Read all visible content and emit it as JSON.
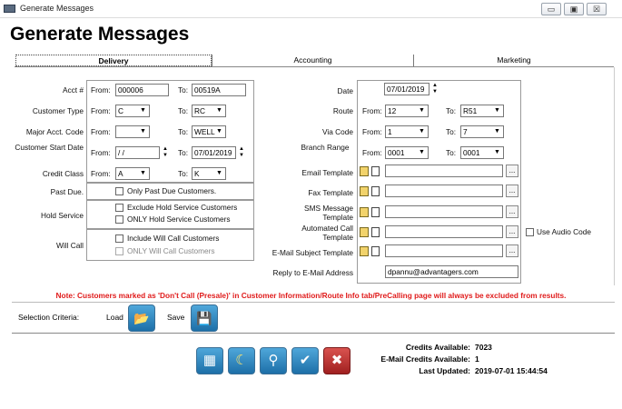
{
  "window": {
    "title": "Generate Messages",
    "minimize": "▭",
    "maximize": "▣",
    "close": "☒"
  },
  "page_title": "Generate Messages",
  "tabs": [
    {
      "label": "Delivery"
    },
    {
      "label": "Accounting"
    },
    {
      "label": "Marketing"
    }
  ],
  "left": {
    "acct": {
      "label": "Acct #",
      "from_label": "From:",
      "from": "000006",
      "to_label": "To:",
      "to": "00519A"
    },
    "customer_type": {
      "label": "Customer Type",
      "from_label": "From:",
      "from": "C",
      "to_label": "To:",
      "to": "RC"
    },
    "major_acct": {
      "label": "Major Acct. Code",
      "from_label": "From:",
      "from": "",
      "to_label": "To:",
      "to": "WELL"
    },
    "start_date": {
      "label": "Customer Start Date",
      "from_label": "From:",
      "from": " / /",
      "to_label": "To:",
      "to": "07/01/2019"
    },
    "credit_class": {
      "label": "Credit Class",
      "from_label": "From:",
      "from": "A",
      "to_label": "To:",
      "to": "K"
    },
    "past_due": {
      "label": "Past Due.",
      "option": "Only Past Due Customers."
    },
    "hold_service": {
      "label": "Hold Service",
      "option1": "Exclude Hold Service Customers",
      "option2": "ONLY Hold Service Customers"
    },
    "will_call": {
      "label": "Will Call",
      "option1": "Include Will Call Customers",
      "option2": "ONLY Will Call Customers"
    }
  },
  "right": {
    "date": {
      "label": "Date",
      "value": "07/01/2019"
    },
    "route": {
      "label": "Route",
      "from_label": "From:",
      "from": "12",
      "to_label": "To:",
      "to": "R51"
    },
    "via_code": {
      "label": "Via Code",
      "from_label": "From:",
      "from": "1",
      "to_label": "To:",
      "to": "7"
    },
    "branch": {
      "label": "Branch Range",
      "from_label": "From:",
      "from": "0001",
      "to_label": "To:",
      "to": "0001"
    },
    "email_template": {
      "label": "Email Template",
      "value": ""
    },
    "fax_template": {
      "label": "Fax Template",
      "value": ""
    },
    "sms_template": {
      "label": "SMS Message Template",
      "value": ""
    },
    "call_template": {
      "label": "Automated Call Template",
      "value": ""
    },
    "subject_template": {
      "label": "E-Mail Subject Template",
      "value": ""
    },
    "reply_to": {
      "label": "Reply to E-Mail Address",
      "value": "dpannu@advantagers.com"
    },
    "use_audio": "Use Audio Code",
    "ellipsis": "..."
  },
  "note": "Note: Customers marked as 'Don't Call (Presale)' in Customer Information/Route Info tab/PreCalling page will always be excluded from results.",
  "selection": {
    "label": "Selection Criteria:",
    "load": "Load",
    "save": "Save"
  },
  "credits": {
    "available_label": "Credits Available:",
    "available": "7023",
    "email_label": "E-Mail Credits Available:",
    "email": "1",
    "updated_label": "Last Updated:",
    "updated": "2019-07-01 15:44:54"
  },
  "icons": {
    "dd": "▼",
    "up": "▲",
    "down": "▼",
    "calendar": "▦",
    "moon": "☾",
    "search": "⚲",
    "check": "✔",
    "close": "✖",
    "folder": "📂",
    "disk": "💾"
  },
  "colors": {
    "note": "#e01b1b",
    "button_blue": "#1d6fa8",
    "cancel_red": "#c0392b"
  }
}
